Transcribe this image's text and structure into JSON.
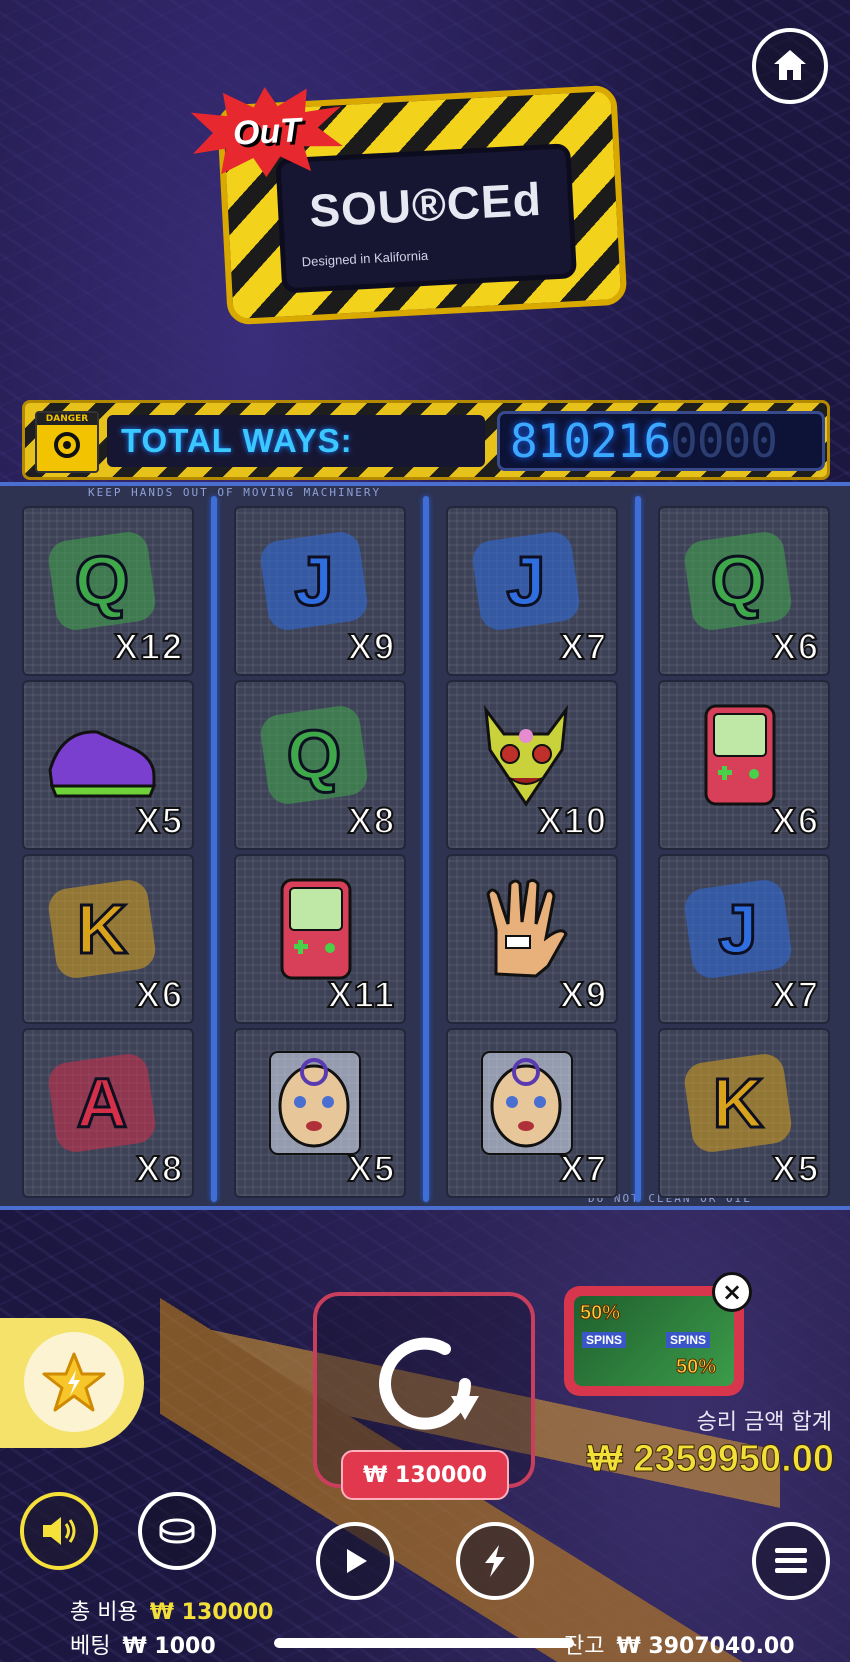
{
  "header": {
    "home_icon": "home-icon"
  },
  "logo": {
    "burst": "OuT",
    "main": "SOU®CEd",
    "sub": "Designed in Kalifornia"
  },
  "ways": {
    "danger_label": "DANGER",
    "label": "TOTAL WAYS:",
    "lit_digits": "810216",
    "dim_digits": "0000"
  },
  "frame": {
    "top_text": "KEEP HANDS OUT OF MOVING MACHINERY",
    "bottom_text": "DO NOT CLEAN OR OIL"
  },
  "grid": {
    "reels": [
      [
        {
          "symbol": "Q",
          "kind": "letter",
          "color": "#3fa84a",
          "mult": "X12"
        },
        {
          "symbol": "sneaker",
          "kind": "item",
          "color": "#7b3fd0",
          "mult": "X5"
        },
        {
          "symbol": "K",
          "kind": "letter",
          "color": "#d9a21b",
          "mult": "X6"
        },
        {
          "symbol": "A",
          "kind": "letter",
          "color": "#d4304a",
          "mult": "X8"
        }
      ],
      [
        {
          "symbol": "J",
          "kind": "letter",
          "color": "#2f6ee0",
          "mult": "X9"
        },
        {
          "symbol": "Q",
          "kind": "letter",
          "color": "#3fa84a",
          "mult": "X8"
        },
        {
          "symbol": "GAYBO",
          "kind": "handheld",
          "color": "#d8405a",
          "mult": "X11"
        },
        {
          "symbol": "doll-head",
          "kind": "doll",
          "color": "#e7c79a",
          "mult": "X5"
        }
      ],
      [
        {
          "symbol": "J",
          "kind": "letter",
          "color": "#2f6ee0",
          "mult": "X7"
        },
        {
          "symbol": "mask",
          "kind": "mask",
          "color": "#c9d23a",
          "mult": "X10"
        },
        {
          "symbol": "glove",
          "kind": "glove",
          "color": "#e8b07a",
          "mult": "X9"
        },
        {
          "symbol": "doll-head",
          "kind": "doll",
          "color": "#e7c79a",
          "mult": "X7"
        }
      ],
      [
        {
          "symbol": "Q",
          "kind": "letter",
          "color": "#3fa84a",
          "mult": "X6"
        },
        {
          "symbol": "GAYBO",
          "kind": "handheld",
          "color": "#d8405a",
          "mult": "X6"
        },
        {
          "symbol": "J",
          "kind": "letter",
          "color": "#2f6ee0",
          "mult": "X7"
        },
        {
          "symbol": "K",
          "kind": "letter",
          "color": "#d9a21b",
          "mult": "X5"
        }
      ]
    ]
  },
  "controls": {
    "favorite_icon": "star-bolt-icon",
    "spin_icon": "spin-arrow-icon",
    "bet_pill": "₩ 130000",
    "promo": {
      "tag_top": "50%",
      "tag_bottom": "50%",
      "text": "SPINS",
      "close": "×"
    },
    "win_label": "승리 금액 합계",
    "win_amount": "₩ 2359950.00",
    "sound_icon": "speaker-icon",
    "coin_icon": "coin-icon",
    "play_icon": "play-icon",
    "turbo_icon": "lightning-icon",
    "menu_icon": "menu-icon"
  },
  "footer": {
    "total_cost_label": "총 비용",
    "total_cost_value": "₩ 130000",
    "bet_label": "베팅",
    "bet_value": "₩ 1000",
    "balance_label": "잔고",
    "balance_value": "₩ 3907040.00"
  },
  "colors": {
    "accent_yellow": "#f3df3a",
    "accent_red": "#e1384d",
    "frame_blue": "#3f6fd6"
  }
}
